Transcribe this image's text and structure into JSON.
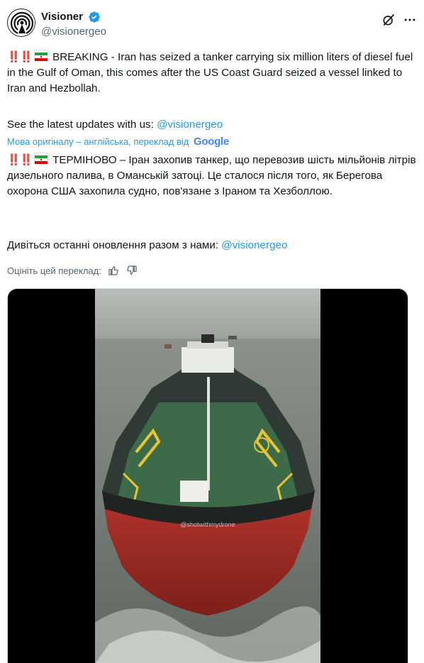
{
  "author": {
    "display_name": "Visioner",
    "handle": "@visionergeo"
  },
  "icons": {
    "verified": "verified-badge-icon",
    "grok": "grok-icon",
    "more": "more-icon",
    "thumbs_up": "thumbs-up-icon",
    "thumbs_down": "thumbs-down-icon"
  },
  "colors": {
    "link": "#1d9bf0",
    "text": "#0f1419",
    "secondary": "#536471"
  },
  "tweet": {
    "alert_emoji": "‼️‼️",
    "original_text": "BREAKING - Iran has seized a tanker carrying six million liters of diesel fuel in the Gulf of Oman, this comes after the US Coast Guard seized a vessel linked to Iran and Hezbollah.",
    "updates_prefix": "See the latest updates with us: ",
    "updates_link": "@visionergeo",
    "translation_note": "Мова оригіналу – англійська, переклад від",
    "translation_provider": "Google",
    "translated_text": "ТЕРМІНОВО – Іран захопив танкер, що перевозив шість мільйонів літрів дизельного палива, в Оманській затоці. Це сталося після того, як Берегова охорона США захопила судно, пов'язане з Іраном та Хезболлою.",
    "translated_updates_prefix": "Дивіться останні оновлення разом з нами: ",
    "translated_updates_link": "@visionergeo",
    "rate_translation": "Оцініть цей переклад:"
  },
  "media": {
    "watermark": "@shotwithmydrone"
  }
}
